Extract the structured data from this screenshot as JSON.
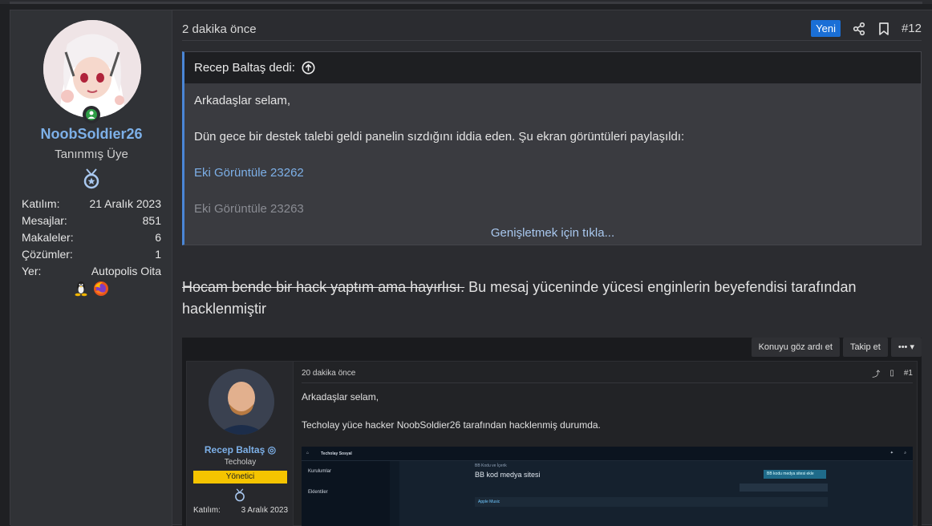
{
  "user": {
    "name": "NoobSoldier26",
    "title": "Tanınmış Üye",
    "stats": [
      {
        "label": "Katılım:",
        "value": "21 Aralık 2023"
      },
      {
        "label": "Mesajlar:",
        "value": "851"
      },
      {
        "label": "Makaleler:",
        "value": "6"
      },
      {
        "label": "Çözümler:",
        "value": "1"
      },
      {
        "label": "Yer:",
        "value": "Autopolis Oita"
      }
    ],
    "os_icons": [
      "linux-icon",
      "firefox-icon"
    ]
  },
  "post": {
    "time": "2 dakika önce",
    "new_badge": "Yeni",
    "number": "#12",
    "quote": {
      "author": "Recep Baltaş dedi:",
      "line1": "Arkadaşlar selam,",
      "line2": "Dün gece bir destek talebi geldi panelin sızdığını iddia eden. Şu ekran görüntüleri paylaşıldı:",
      "link1": "Eki Görüntüle 23262",
      "link2": "Eki Görüntüle 23263",
      "expand": "Genişletmek için tıkla..."
    },
    "message_struck": "Hocam bende bir hack yaptım ama hayırlısı.",
    "message_rest": " Bu mesaj yüceninde yücesi enginlerin beyefendisi tarafından hacklenmiştir"
  },
  "screenshot": {
    "topbar": {
      "ignore": "Konuyu göz ardı et",
      "follow": "Takip et",
      "more": "•••"
    },
    "user": {
      "name": "Recep Baltaş",
      "title": "Techolay",
      "role": "Yönetici",
      "join_label": "Katılım:",
      "join_value": "3 Aralık 2023"
    },
    "post": {
      "time": "20 dakika önce",
      "number": "#1",
      "line1": "Arkadaşlar selam,",
      "line2": "Techolay yüce hacker NoobSoldier26 tarafından hacklenmiş durumda."
    },
    "inner": {
      "brand": "Techolay Sosyal",
      "crumb": "BB Kodu ve İçerik",
      "heading": "BB kod medya sitesi",
      "side1": "Kurulumlar",
      "side2": "Eklentiler",
      "btn": "BB kodu medya sitesi ekle",
      "row": "Apple Music"
    }
  },
  "colors": {
    "accent": "#1a6fd6",
    "link": "#7db0e8",
    "quote_border": "#4a86d6",
    "role": "#f5c400"
  }
}
